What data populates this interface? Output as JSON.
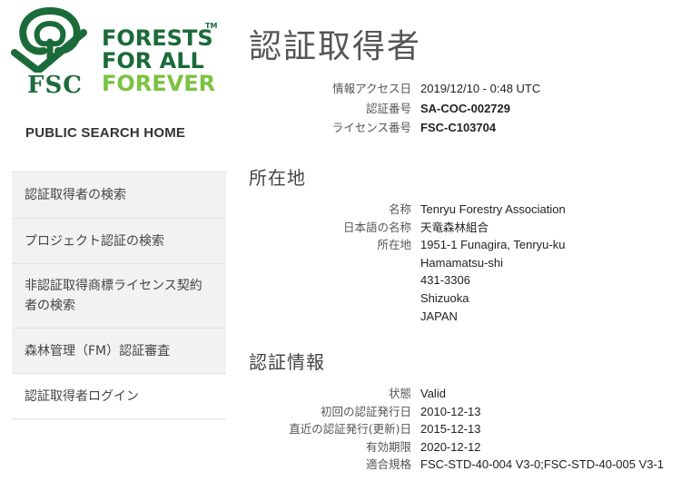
{
  "logo": {
    "brand": "FSC",
    "slogan_line1": "FORESTS",
    "slogan_line2": "FOR ALL",
    "slogan_line3": "FOREVER",
    "trademark": "TM",
    "colors": {
      "dark_green": "#1b6b3a",
      "light_green": "#7cc242"
    },
    "icon": "fsc-tree-check-icon"
  },
  "sidebar": {
    "home_label": "PUBLIC SEARCH HOME",
    "items": [
      {
        "label": "認証取得者の検索"
      },
      {
        "label": "プロジェクト認証の検索"
      },
      {
        "label": "非認証取得商標ライセンス契約者の検索"
      },
      {
        "label": "森林管理（FM）認証審査"
      },
      {
        "label": "認証取得者ログイン"
      }
    ]
  },
  "page": {
    "title": "認証取得者"
  },
  "summary": {
    "access_date_label": "情報アクセス日",
    "access_date": "2019/12/10 - 0:48 UTC",
    "cert_number_label": "認証番号",
    "cert_number": "SA-COC-002729",
    "license_number_label": "ライセンス番号",
    "license_number": "FSC-C103704"
  },
  "location": {
    "section_title": "所在地",
    "name_label": "名称",
    "name": "Tenryu Forestry Association",
    "jp_name_label": "日本語の名称",
    "jp_name": "天竜森林組合",
    "address_label": "所在地",
    "address_lines": [
      "1951-1 Funagira, Tenryu-ku",
      "Hamamatsu-shi",
      "431-3306",
      "Shizuoka",
      "JAPAN"
    ]
  },
  "cert_info": {
    "section_title": "認証情報",
    "status_label": "状態",
    "status": "Valid",
    "first_issue_label": "初回の認証発行日",
    "first_issue": "2010-12-13",
    "latest_issue_label": "直近の認証発行(更新)日",
    "latest_issue": "2015-12-13",
    "expiry_label": "有効期限",
    "expiry": "2020-12-12",
    "standards_label": "適合規格",
    "standards": "FSC-STD-40-004 V3-0;FSC-STD-40-005 V3-1"
  }
}
